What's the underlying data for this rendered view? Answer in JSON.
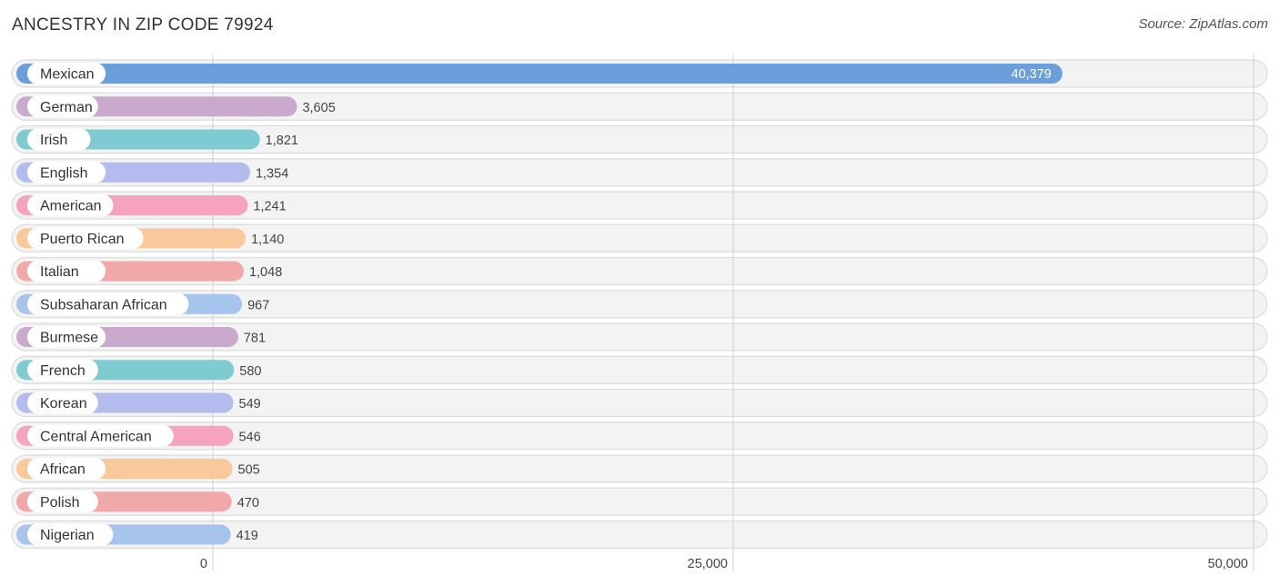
{
  "chart_data": {
    "type": "bar",
    "orientation": "horizontal",
    "title": "ANCESTRY IN ZIP CODE 79924",
    "source": "Source: ZipAtlas.com",
    "xlabel": "",
    "ylabel": "",
    "xlim": [
      0,
      50000
    ],
    "grid": true,
    "x_ticks": [
      {
        "value": 0,
        "label": "0"
      },
      {
        "value": 25000,
        "label": "25,000"
      },
      {
        "value": 50000,
        "label": "50,000"
      }
    ],
    "categories": [
      "Mexican",
      "German",
      "Irish",
      "English",
      "American",
      "Puerto Rican",
      "Italian",
      "Subsaharan African",
      "Burmese",
      "French",
      "Korean",
      "Central American",
      "African",
      "Polish",
      "Nigerian"
    ],
    "values": [
      40379,
      3605,
      1821,
      1354,
      1241,
      1140,
      1048,
      967,
      781,
      580,
      549,
      546,
      505,
      470,
      419
    ],
    "value_labels": [
      "40,379",
      "3,605",
      "1,821",
      "1,354",
      "1,241",
      "1,140",
      "1,048",
      "967",
      "781",
      "580",
      "549",
      "546",
      "505",
      "470",
      "419"
    ],
    "colors": [
      "#6a9fdb",
      "#c9a9cc",
      "#7ecbd1",
      "#b3bcec",
      "#f5a3bf",
      "#f9c99c",
      "#f0a9a8",
      "#a7c5ec",
      "#c9a9cc",
      "#7ecbd1",
      "#b3bcec",
      "#f5a3bf",
      "#f9c99c",
      "#f0a9a8",
      "#a7c5ec"
    ]
  }
}
